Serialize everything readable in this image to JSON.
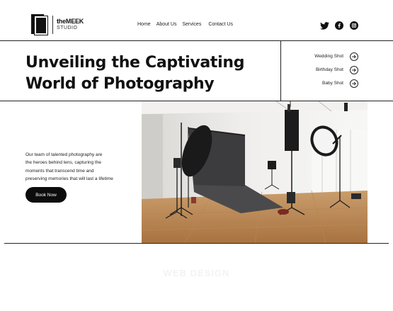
{
  "logo": {
    "brand_the": "the",
    "brand_meek": "MEEK",
    "brand_studio": "STUDIO"
  },
  "nav": {
    "items": [
      "Home",
      "About Us",
      "Services",
      "Contact Us"
    ]
  },
  "social": {
    "icons": [
      "twitter-icon",
      "facebook-icon",
      "instagram-icon"
    ]
  },
  "hero": {
    "title_line1": "Unveiling the Captivating",
    "title_line2": "World of Photography"
  },
  "services": {
    "items": [
      "Wedding Shot",
      "Birthday Shot",
      "Baby Shot"
    ]
  },
  "intro": {
    "line1": "Our team of talented photography are",
    "line2": "the heroes behind lens, capturing the",
    "line3": "moments that transcend time and",
    "line4": "preserving memories that will last a lifetime",
    "button_label": "Book Now"
  },
  "footer": {
    "watermark": "WEB DESIGN"
  },
  "colors": {
    "ink": "#111111",
    "button_bg": "#0c0c0c",
    "background": "#ffffff"
  }
}
